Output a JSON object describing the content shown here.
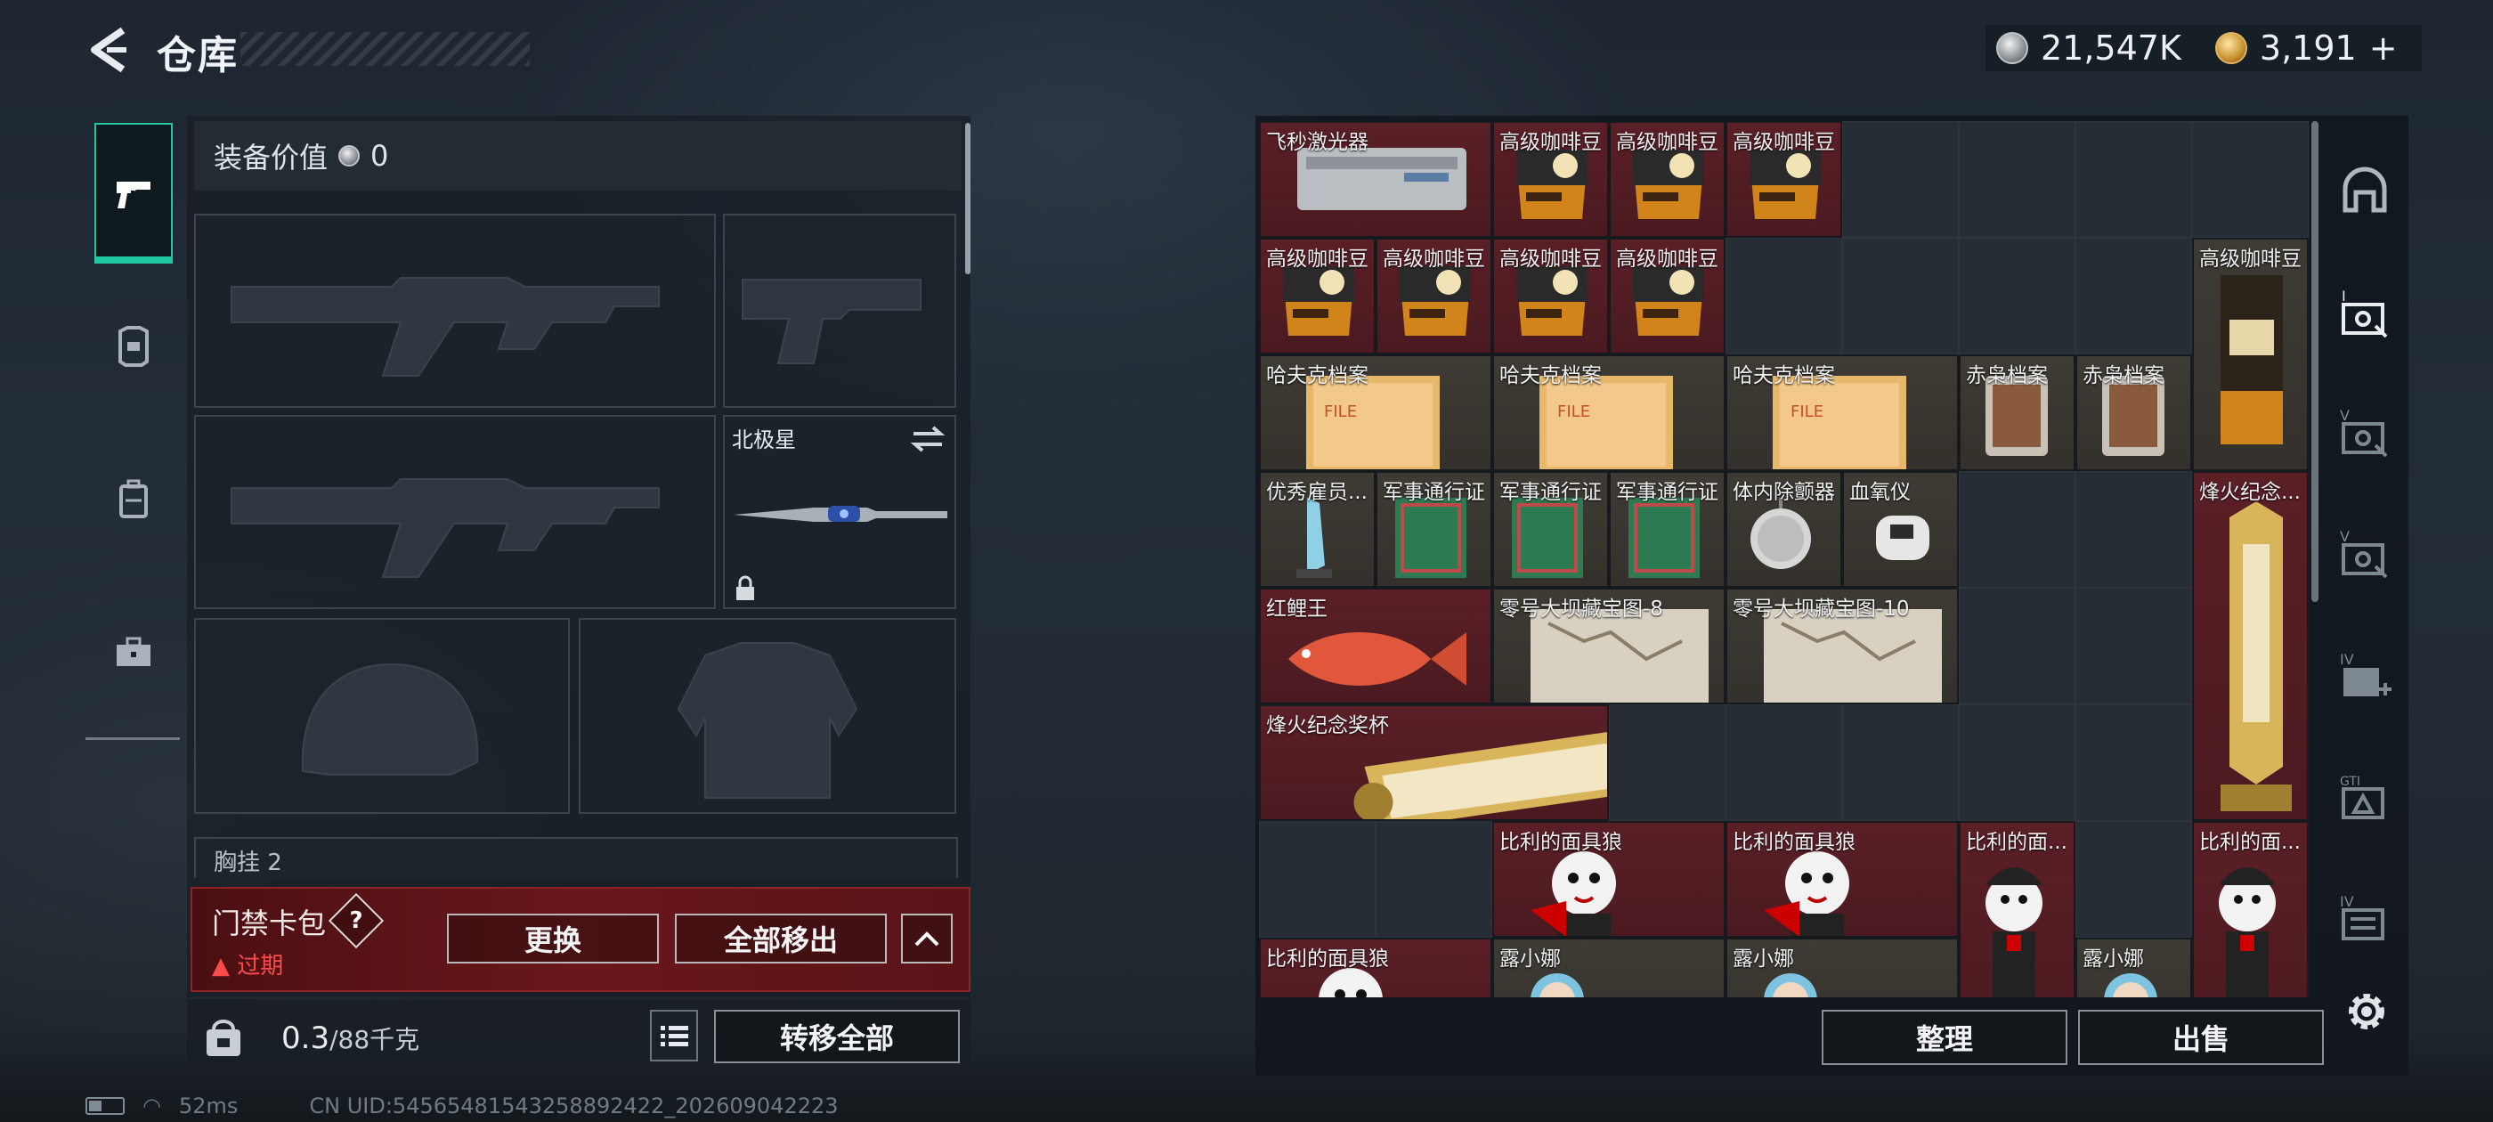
{
  "header": {
    "title": "仓库",
    "silver_amount": "21,547K",
    "gold_amount": "3,191",
    "gold_plus": "+"
  },
  "equipment": {
    "value_label": "装备价值",
    "value_amount": "0",
    "melee_name": "北极星",
    "peek_text": "胸挂 2"
  },
  "card_pack": {
    "title": "门禁卡包",
    "help": "?",
    "status": "过期",
    "replace_label": "更换",
    "remove_all_label": "全部移出"
  },
  "backpack": {
    "weight_current": "0.3",
    "weight_max": "/88千克",
    "transfer_all_label": "转移全部"
  },
  "status_bar": {
    "ping": "52ms",
    "uid": "CN UID:54565481543258892422_202609042223"
  },
  "stash": {
    "items": [
      {
        "name": "飞秒激光器"
      },
      {
        "name": "高级咖啡豆"
      },
      {
        "name": "高级咖啡豆"
      },
      {
        "name": "高级咖啡豆"
      },
      {
        "name": "高级咖啡豆"
      },
      {
        "name": "高级咖啡豆"
      },
      {
        "name": "高级咖啡豆"
      },
      {
        "name": "高级咖啡豆"
      },
      {
        "name": "高级咖啡豆"
      },
      {
        "name": "哈夫克档案"
      },
      {
        "name": "哈夫克档案"
      },
      {
        "name": "哈夫克档案"
      },
      {
        "name": "赤枭档案"
      },
      {
        "name": "赤枭档案"
      },
      {
        "name": "优秀雇员..."
      },
      {
        "name": "军事通行证"
      },
      {
        "name": "军事通行证"
      },
      {
        "name": "军事通行证"
      },
      {
        "name": "体内除颤器"
      },
      {
        "name": "血氧仪"
      },
      {
        "name": "烽火纪念..."
      },
      {
        "name": "红鲤王"
      },
      {
        "name": "零号大坝藏宝图-8"
      },
      {
        "name": "零号大坝藏宝图-10"
      },
      {
        "name": "烽火纪念奖杯"
      },
      {
        "name": "比利的面具狼"
      },
      {
        "name": "比利的面具狼"
      },
      {
        "name": "比利的面..."
      },
      {
        "name": "比利的面..."
      },
      {
        "name": "比利的面具狼"
      },
      {
        "name": "露小娜"
      },
      {
        "name": "露小娜"
      },
      {
        "name": "露小娜"
      }
    ],
    "sort_label": "整理",
    "sell_label": "出售"
  },
  "icons": {
    "back": "back-arrow-icon",
    "silver": "silver-coin-icon",
    "gold": "gold-coin-icon",
    "gear": "gear-icon"
  },
  "colors": {
    "accent": "#20c9a0",
    "warning": "#ff4a4a",
    "item_red": "#5b1f26",
    "item_gold": "#3e3a34"
  }
}
